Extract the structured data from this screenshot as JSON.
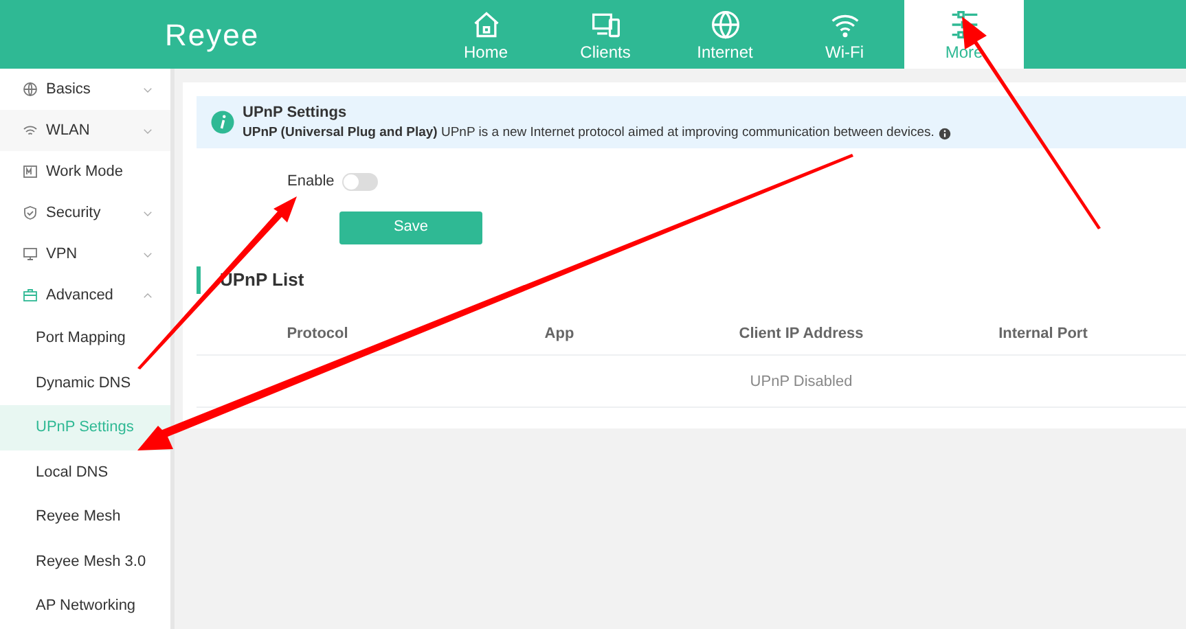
{
  "header": {
    "logo": "Reyee",
    "nav": [
      {
        "label": "Home",
        "selected": false
      },
      {
        "label": "Clients",
        "selected": false
      },
      {
        "label": "Internet",
        "selected": false
      },
      {
        "label": "Wi-Fi",
        "selected": false
      },
      {
        "label": "More",
        "selected": true
      }
    ]
  },
  "sidebar": {
    "items": [
      {
        "label": "Basics",
        "expanded": false,
        "selected": false
      },
      {
        "label": "WLAN",
        "expanded": false,
        "selected": false
      },
      {
        "label": "Work Mode",
        "selected": false
      },
      {
        "label": "Security",
        "expanded": false,
        "selected": false
      },
      {
        "label": "VPN",
        "expanded": false,
        "selected": false
      },
      {
        "label": "Advanced",
        "expanded": true,
        "selected": false,
        "children": [
          {
            "label": "Port Mapping",
            "selected": false
          },
          {
            "label": "Dynamic DNS",
            "selected": false
          },
          {
            "label": "UPnP Settings",
            "selected": true
          },
          {
            "label": "Local DNS",
            "selected": false
          },
          {
            "label": "Reyee Mesh",
            "selected": false
          },
          {
            "label": "Reyee Mesh 3.0",
            "selected": false
          },
          {
            "label": "AP Networking",
            "selected": false
          }
        ]
      }
    ]
  },
  "info": {
    "title": "UPnP Settings",
    "text": "**UPnP  (Universal Plug and Play)** UPnP is a new Internet protocol aimed at improving communication between devices."
  },
  "form": {
    "enable_label": "Enable",
    "enable_on": false,
    "save": "Save"
  },
  "list": {
    "title": "UPnP List",
    "columns": [
      "Protocol",
      "App",
      "Client IP Address",
      "Internal Port"
    ],
    "empty": "UPnP Disabled"
  }
}
